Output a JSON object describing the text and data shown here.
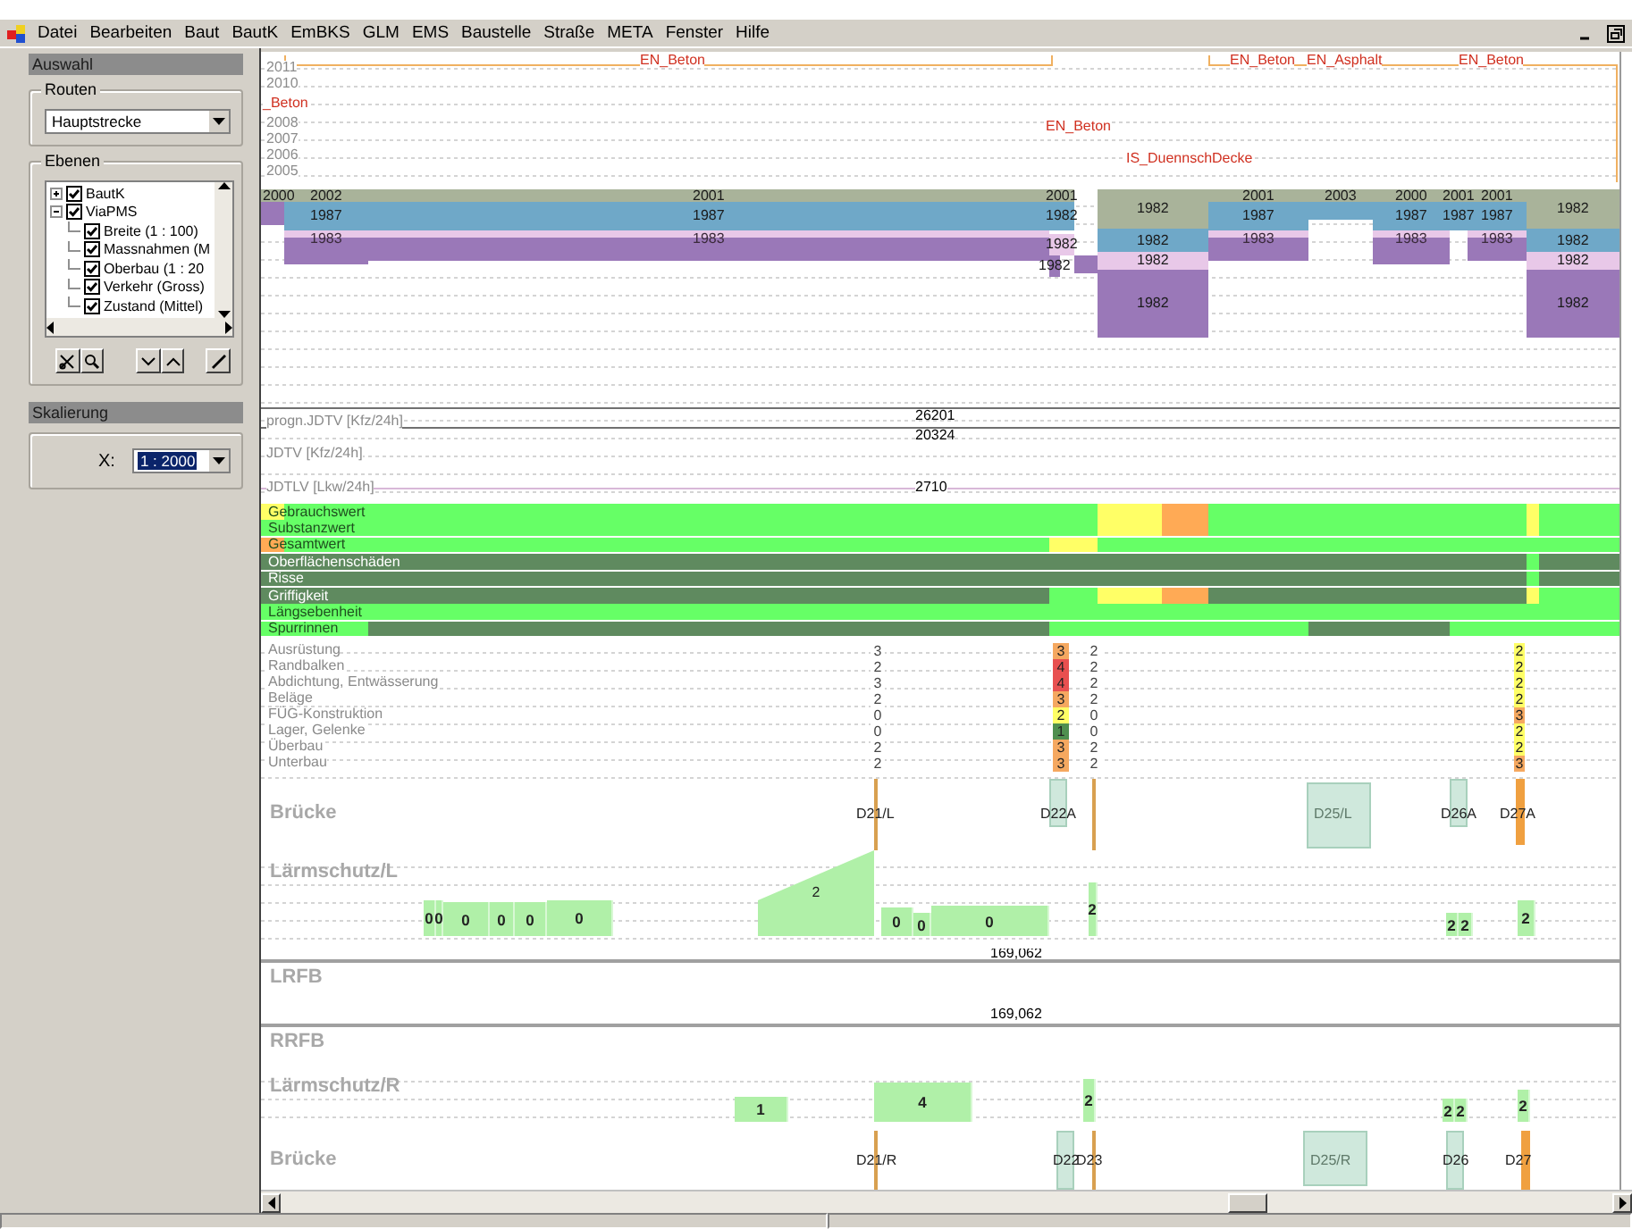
{
  "menu": [
    "Datei",
    "Bearbeiten",
    "Baut",
    "BautK",
    "EmBKS",
    "GLM",
    "EMS",
    "Baustelle",
    "Straße",
    "META",
    "Fenster",
    "Hilfe"
  ],
  "left_panel": {
    "selection_header": "Auswahl",
    "routes": {
      "label": "Routen",
      "value": "Hauptstrecke"
    },
    "layers": {
      "label": "Ebenen",
      "tree": [
        {
          "label": "BautK",
          "checked": true,
          "expanded": false
        },
        {
          "label": "ViaPMS",
          "checked": true,
          "expanded": true,
          "children": [
            {
              "label": "Breite (1 : 100)",
              "checked": true
            },
            {
              "label": "Massnahmen (M",
              "checked": true
            },
            {
              "label": "Oberbau (1 : 20",
              "checked": true
            },
            {
              "label": "Verkehr (Gross)",
              "checked": true
            },
            {
              "label": "Zustand (Mittel)",
              "checked": true
            }
          ]
        }
      ]
    },
    "scale_header": "Skalierung",
    "scale": {
      "label": "X:",
      "value": "1 : 2000",
      "highlighted": true
    }
  },
  "measures": {
    "years": [
      "2011",
      "2010",
      "2008",
      "2007",
      "2006",
      "2005"
    ],
    "items": [
      {
        "label": "EN_Beton"
      },
      {
        "label": "EN_Beton"
      },
      {
        "label": "EN_Asphalt"
      },
      {
        "label": "EN_Beton"
      },
      {
        "label": "_Beton"
      },
      {
        "label": "EN_Beton"
      },
      {
        "label": "IS_DuennschDecke"
      }
    ]
  },
  "layers_chart": {
    "blocks": [
      {
        "label": "2000",
        "color": "#a9b39a"
      },
      {
        "label": "2002",
        "color": "#a9b39a"
      },
      {
        "label": "2001",
        "color": "#a9b39a"
      },
      {
        "label": "2001",
        "color": "#a9b39a"
      },
      {
        "label": "1982",
        "color": "#a9b39a"
      },
      {
        "label": "2001",
        "color": "#a9b39a"
      },
      {
        "label": "2003",
        "color": "#a9b39a"
      },
      {
        "label": "2000",
        "color": "#a9b39a"
      },
      {
        "label": "2001",
        "color": "#a9b39a"
      },
      {
        "label": "2001",
        "color": "#a9b39a"
      },
      {
        "label": "1982",
        "color": "#a9b39a"
      },
      {
        "color": "#9a78b8"
      },
      {
        "label": "1987",
        "color": "#6fa8c8"
      },
      {
        "label": "1987",
        "color": "#6fa8c8"
      },
      {
        "label": "1982",
        "color": "#6fa8c8"
      },
      {
        "label": "1987",
        "color": "#6fa8c8"
      },
      {
        "color": "#6fa8c8"
      },
      {
        "label": "1987",
        "color": "#6fa8c8"
      },
      {
        "label": "1987",
        "color": "#6fa8c8"
      },
      {
        "label": "1987",
        "color": "#6fa8c8"
      },
      {
        "label": "1983",
        "color": "#e8c8e8"
      },
      {
        "label": "1983",
        "color": "#e8c8e8"
      },
      {
        "label": "1982",
        "color": "#e8c8e8"
      },
      {
        "label": "1982",
        "color": "#6fa8c8"
      },
      {
        "label": "1983",
        "color": "#e8c8e8"
      },
      {
        "label": "1983",
        "color": "#e8c8e8"
      },
      {
        "label": "1983",
        "color": "#e8c8e8"
      },
      {
        "label": "1982",
        "color": "#6fa8c8"
      },
      {
        "color": "#9a78b8"
      },
      {
        "color": "#9a78b8"
      },
      {
        "color": "#9a78b8"
      },
      {
        "color": "#9a78b8"
      },
      {
        "color": "#9a78b8"
      },
      {
        "label": "1982",
        "color": "#9a78b8"
      },
      {
        "color": "#9a78b8"
      },
      {
        "label": "1982",
        "color": "#e8c8e8"
      },
      {
        "label": "1982",
        "color": "#e8c8e8"
      },
      {
        "label": "1982",
        "color": "#9a78b8"
      },
      {
        "label": "1982",
        "color": "#9a78b8"
      }
    ]
  },
  "traffic": {
    "rows": [
      {
        "label": "progn.JDTV [Kfz/24h]",
        "value": "26201"
      },
      {
        "label": "JDTV [Kfz/24h]",
        "value": "20324"
      },
      {
        "label": "JDTLV [Lkw/24h]",
        "value": "2710"
      }
    ]
  },
  "condition": {
    "rows": [
      {
        "label": "Gebrauchswert",
        "cells": [
          {
            "color": "#ffff66"
          },
          {
            "color": "#66ff66"
          },
          {
            "color": "#66ff66"
          },
          {
            "color": "#66ff66"
          },
          {
            "color": "#66ff66"
          },
          {
            "color": "#ffff66"
          },
          {
            "color": "#ffaa55"
          },
          {
            "color": "#66ff66"
          },
          {
            "color": "#66ff66"
          },
          {
            "color": "#66ff66"
          },
          {
            "color": "#66ff66"
          },
          {
            "color": "#ffff66"
          },
          {
            "color": "#66ff66"
          }
        ]
      },
      {
        "label": "Substanzwert",
        "cells": [
          {
            "color": "#66ff66"
          },
          {
            "color": "#66ff66"
          },
          {
            "color": "#66ff66"
          },
          {
            "color": "#66ff66"
          },
          {
            "color": "#66ff66"
          },
          {
            "color": "#ffff66"
          },
          {
            "color": "#ffaa55"
          },
          {
            "color": "#66ff66"
          },
          {
            "color": "#66ff66"
          },
          {
            "color": "#66ff66"
          },
          {
            "color": "#66ff66"
          },
          {
            "color": "#ffff66"
          },
          {
            "color": "#66ff66"
          }
        ]
      },
      {
        "label": "Gesamtwert",
        "cells": [
          {
            "color": "#ffaa55"
          },
          {
            "color": "#66ff66"
          },
          {
            "color": "#66ff66"
          },
          {
            "color": "#ffff66"
          },
          {
            "color": "#ffff66"
          },
          {
            "color": "#66ff66"
          },
          {
            "color": "#66ff66"
          },
          {
            "color": "#66ff66"
          },
          {
            "color": "#66ff66"
          },
          {
            "color": "#66ff66"
          },
          {
            "color": "#66ff66"
          },
          {
            "color": "#66ff66"
          },
          {
            "color": "#66ff66"
          }
        ]
      },
      {
        "label": "Oberflächenschäden",
        "cells": [
          {
            "color": "#5f8a5f"
          },
          {
            "color": "#5f8a5f"
          },
          {
            "color": "#5f8a5f"
          },
          {
            "color": "#5f8a5f"
          },
          {
            "color": "#5f8a5f"
          },
          {
            "color": "#5f8a5f"
          },
          {
            "color": "#5f8a5f"
          },
          {
            "color": "#5f8a5f"
          },
          {
            "color": "#5f8a5f"
          },
          {
            "color": "#5f8a5f"
          },
          {
            "color": "#5f8a5f"
          },
          {
            "color": "#66ff66"
          },
          {
            "color": "#5f8a5f"
          }
        ]
      },
      {
        "label": "Risse",
        "cells": [
          {
            "color": "#5f8a5f"
          },
          {
            "color": "#5f8a5f"
          },
          {
            "color": "#5f8a5f"
          },
          {
            "color": "#5f8a5f"
          },
          {
            "color": "#5f8a5f"
          },
          {
            "color": "#5f8a5f"
          },
          {
            "color": "#5f8a5f"
          },
          {
            "color": "#5f8a5f"
          },
          {
            "color": "#5f8a5f"
          },
          {
            "color": "#5f8a5f"
          },
          {
            "color": "#5f8a5f"
          },
          {
            "color": "#66ff66"
          },
          {
            "color": "#5f8a5f"
          }
        ]
      },
      {
        "label": "Griffigkeit",
        "cells": [
          {
            "color": "#5f8a5f"
          },
          {
            "color": "#5f8a5f"
          },
          {
            "color": "#5f8a5f"
          },
          {
            "color": "#66ff66"
          },
          {
            "color": "#66ff66"
          },
          {
            "color": "#ffff66"
          },
          {
            "color": "#ffaa55"
          },
          {
            "color": "#5f8a5f"
          },
          {
            "color": "#5f8a5f"
          },
          {
            "color": "#5f8a5f"
          },
          {
            "color": "#5f8a5f"
          },
          {
            "color": "#ffff66"
          },
          {
            "color": "#66ff66"
          }
        ]
      },
      {
        "label": "Längsebenheit",
        "cells": [
          {
            "color": "#66ff66"
          },
          {
            "color": "#66ff66"
          },
          {
            "color": "#66ff66"
          },
          {
            "color": "#66ff66"
          },
          {
            "color": "#66ff66"
          },
          {
            "color": "#66ff66"
          },
          {
            "color": "#66ff66"
          },
          {
            "color": "#66ff66"
          },
          {
            "color": "#66ff66"
          },
          {
            "color": "#66ff66"
          },
          {
            "color": "#66ff66"
          },
          {
            "color": "#66ff66"
          },
          {
            "color": "#66ff66"
          }
        ]
      },
      {
        "label": "Spurrinnen",
        "cells": [
          {
            "color": "#66ff66"
          },
          {
            "color": "#66ff66"
          },
          {
            "color": "#5f8a5f"
          },
          {
            "color": "#66ff66"
          },
          {
            "color": "#66ff66"
          },
          {
            "color": "#66ff66"
          },
          {
            "color": "#66ff66"
          },
          {
            "color": "#66ff66"
          },
          {
            "color": "#5f8a5f"
          },
          {
            "color": "#5f8a5f"
          },
          {
            "color": "#66ff66"
          },
          {
            "color": "#66ff66"
          },
          {
            "color": "#66ff66"
          }
        ]
      }
    ]
  },
  "bridge_grades": {
    "rows": [
      "Ausrüstung",
      "Randbalken",
      "Abdichtung, Entwässerung",
      "Beläge",
      "FÜG-Konstruktion",
      "Lager, Gelenke",
      "Überbau",
      "Unterbau"
    ],
    "columns": [
      {
        "kind": "text",
        "values": [
          {
            "text": "3"
          },
          {
            "text": "2"
          },
          {
            "text": "3"
          },
          {
            "text": "2"
          },
          {
            "text": "0"
          },
          {
            "text": "0"
          },
          {
            "text": "2"
          },
          {
            "text": "2"
          }
        ]
      },
      {
        "kind": "box",
        "values": [
          {
            "text": "3",
            "color": "#f5a860"
          },
          {
            "text": "4",
            "color": "#e85050"
          },
          {
            "text": "4",
            "color": "#e85050"
          },
          {
            "text": "3",
            "color": "#f5a860"
          },
          {
            "text": "2",
            "color": "#ffff66"
          },
          {
            "text": "1",
            "color": "#4f8f4f"
          },
          {
            "text": "3",
            "color": "#f5a860"
          },
          {
            "text": "3",
            "color": "#f5a860"
          }
        ]
      },
      {
        "kind": "text",
        "values": [
          {
            "text": "2"
          },
          {
            "text": "2"
          },
          {
            "text": "2"
          },
          {
            "text": "2"
          },
          {
            "text": "0"
          },
          {
            "text": "0"
          },
          {
            "text": "2"
          },
          {
            "text": "2"
          }
        ]
      },
      {
        "kind": "box",
        "values": [
          {
            "text": "2",
            "color": "#ffff66"
          },
          {
            "text": "2",
            "color": "#ffff66"
          },
          {
            "text": "2",
            "color": "#ffff66"
          },
          {
            "text": "2",
            "color": "#ffff66"
          },
          {
            "text": "3",
            "color": "#f5a860"
          },
          {
            "text": "2",
            "color": "#ffff66"
          },
          {
            "text": "2",
            "color": "#ffff66"
          },
          {
            "text": "3",
            "color": "#f5a860"
          }
        ]
      }
    ]
  },
  "bridges_left": {
    "label": "Brücke",
    "items": [
      {
        "label": "D21/L",
        "kind": "line"
      },
      {
        "label": "D22A",
        "kind": "box"
      },
      {
        "kind": "line"
      },
      {
        "label": "D25/L",
        "kind": "box"
      },
      {
        "label": "D26A",
        "kind": "box"
      },
      {
        "label": "D27A",
        "kind": "bar"
      }
    ]
  },
  "noise_left": {
    "label": "Lärmschutz/L",
    "items": [
      {
        "label": "0",
        "kind": "block"
      },
      {
        "label": "0",
        "kind": "block"
      },
      {
        "label": "0",
        "kind": "block"
      },
      {
        "label": "0",
        "kind": "block"
      },
      {
        "label": "0",
        "kind": "block"
      },
      {
        "label": "0",
        "kind": "block"
      },
      {
        "label": "2",
        "kind": "ramp"
      },
      {
        "label": "0",
        "kind": "block"
      },
      {
        "label": "0",
        "kind": "block"
      },
      {
        "label": "0",
        "kind": "block"
      },
      {
        "label": "2",
        "kind": "block"
      },
      {
        "label": "2",
        "kind": "block"
      },
      {
        "label": "2",
        "kind": "block"
      },
      {
        "label": "2",
        "kind": "block"
      }
    ]
  },
  "lrfb": {
    "label": "LRFB",
    "value": "169,062"
  },
  "rrfb": {
    "label": "RRFB",
    "value": "169,062"
  },
  "noise_right": {
    "label": "Lärmschutz/R",
    "items": [
      {
        "label": "1",
        "kind": "block"
      },
      {
        "label": "4",
        "kind": "block"
      },
      {
        "label": "2",
        "kind": "block"
      },
      {
        "label": "2",
        "kind": "block"
      },
      {
        "label": "2",
        "kind": "block"
      },
      {
        "label": "2",
        "kind": "block"
      }
    ]
  },
  "bridges_right": {
    "label": "Brücke",
    "items": [
      {
        "label": "D21/R",
        "kind": "line"
      },
      {
        "label": "D22",
        "kind": "box"
      },
      {
        "label": "D23",
        "kind": "line"
      },
      {
        "label": "D25/R",
        "kind": "box"
      },
      {
        "label": "D26",
        "kind": "box"
      },
      {
        "label": "D27",
        "kind": "bar"
      }
    ]
  }
}
